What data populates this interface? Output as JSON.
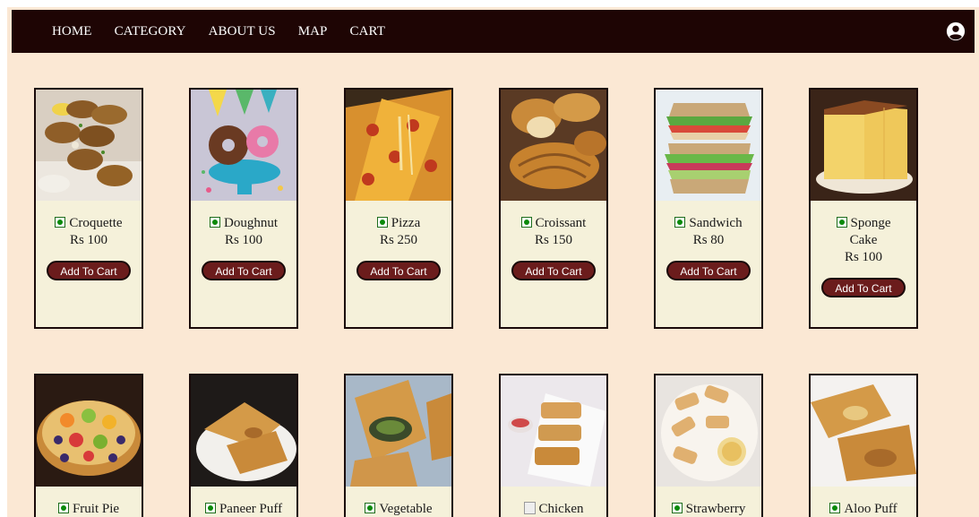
{
  "nav": {
    "links": [
      "HOME",
      "CATEGORY",
      "ABOUT US",
      "MAP",
      "CART"
    ],
    "account_icon": "account-circle-icon"
  },
  "products_row1": [
    {
      "name": "Croquette",
      "price": "Rs 100",
      "button": "Add To Cart"
    },
    {
      "name": "Doughnut",
      "price": "Rs 100",
      "button": "Add To Cart"
    },
    {
      "name": "Pizza",
      "price": "Rs 250",
      "button": "Add To Cart"
    },
    {
      "name": "Croissant",
      "price": "Rs 150",
      "button": "Add To Cart"
    },
    {
      "name": "Sandwich",
      "price": "Rs 80",
      "button": "Add To Cart"
    },
    {
      "name": "Sponge Cake",
      "price": "Rs 100",
      "button": "Add To Cart"
    }
  ],
  "products_row2": [
    {
      "name": "Fruit Pie"
    },
    {
      "name": "Paneer Puff"
    },
    {
      "name": "Vegetable"
    },
    {
      "name": "Chicken"
    },
    {
      "name": "Strawberry"
    },
    {
      "name": "Aloo Puff"
    }
  ],
  "colors": {
    "navbar": "#1e0504",
    "page_bg": "#fbe8d4",
    "card_bg": "#f5f1da",
    "button": "#6b1c1c",
    "veg_mark": "#0a8a0a"
  }
}
